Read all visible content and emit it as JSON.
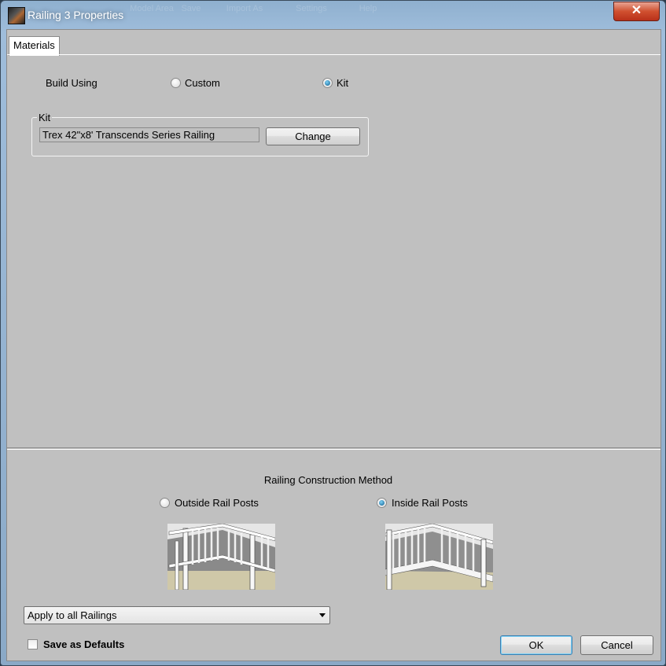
{
  "window": {
    "title": "Railing 3 Properties",
    "close_glyph": "✕",
    "background_toolbar": [
      "Model Area",
      "Save",
      "Import As",
      "Settings",
      "Help"
    ]
  },
  "tabs": [
    {
      "label": "Materials",
      "selected": true
    }
  ],
  "build_using": {
    "label": "Build Using",
    "options": [
      {
        "label": "Custom",
        "selected": false
      },
      {
        "label": "Kit",
        "selected": true
      }
    ]
  },
  "kit": {
    "group_label": "Kit",
    "value": "Trex 42\"x8' Transcends Series Railing",
    "change_label": "Change"
  },
  "construction_method": {
    "title": "Railing Construction Method",
    "options": [
      {
        "label": "Outside Rail Posts",
        "selected": false,
        "image": "outside-posts-preview"
      },
      {
        "label": "Inside Rail Posts",
        "selected": true,
        "image": "inside-posts-preview"
      }
    ]
  },
  "apply_dropdown": {
    "selected": "Apply to all Railings"
  },
  "save_defaults": {
    "label": "Save as Defaults",
    "checked": false
  },
  "buttons": {
    "ok": "OK",
    "cancel": "Cancel"
  },
  "colors": {
    "dialog_bg": "#c0c0c0",
    "titlebar": "#9fbddb",
    "close": "#d0502f",
    "radio_dot": "#0d5e90"
  }
}
